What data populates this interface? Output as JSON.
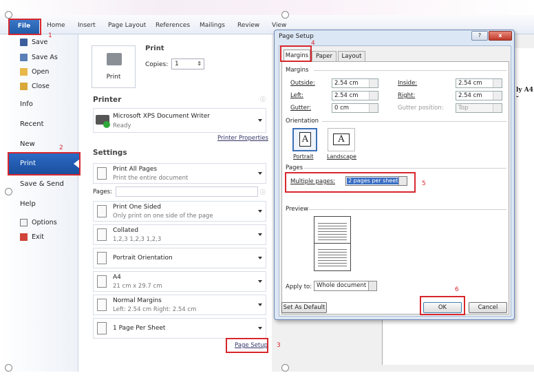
{
  "ribbon": {
    "file": "File",
    "tabs": [
      "Home",
      "Insert",
      "Page Layout",
      "References",
      "Mailings",
      "Review",
      "View"
    ]
  },
  "nav": {
    "items": [
      {
        "label": "Save",
        "icon": "save-icon"
      },
      {
        "label": "Save As",
        "icon": "save-as-icon"
      },
      {
        "label": "Open",
        "icon": "open-folder-icon"
      },
      {
        "label": "Close",
        "icon": "close-folder-icon"
      }
    ],
    "info": "Info",
    "recent": "Recent",
    "new": "New",
    "print": "Print",
    "save_send": "Save & Send",
    "help": "Help",
    "options": "Options",
    "exit": "Exit"
  },
  "print": {
    "heading": "Print",
    "button": "Print",
    "copies_label": "Copies:",
    "copies_value": "1"
  },
  "printer": {
    "heading": "Printer",
    "name": "Microsoft XPS Document Writer",
    "status": "Ready",
    "properties_link": "Printer Properties"
  },
  "settings": {
    "heading": "Settings",
    "pages_label": "Pages:",
    "page_setup_link": "Page Setup",
    "options": [
      {
        "main": "Print All Pages",
        "sub": "Print the entire document"
      },
      {
        "main": "Print One Sided",
        "sub": "Only print on one side of the page"
      },
      {
        "main": "Collated",
        "sub": "1,2,3   1,2,3   1,2,3"
      },
      {
        "main": "Portrait Orientation",
        "sub": ""
      },
      {
        "main": "A4",
        "sub": "21 cm x 29.7 cm"
      },
      {
        "main": "Normal Margins",
        "sub": "Left: 2.54 cm   Right: 2.54 cm"
      },
      {
        "main": "1 Page Per Sheet",
        "sub": ""
      }
    ]
  },
  "dialog": {
    "title": "Page Setup",
    "tabs": [
      "Margins",
      "Paper",
      "Layout"
    ],
    "margins_group": "Margins",
    "outside_label": "Outside:",
    "outside_value": "2.54 cm",
    "inside_label": "Inside:",
    "inside_value": "2.54 cm",
    "left_label": "Left:",
    "left_value": "2.54 cm",
    "right_label": "Right:",
    "right_value": "2.54 cm",
    "gutter_label": "Gutter:",
    "gutter_value": "0 cm",
    "gutter_pos_label": "Gutter position:",
    "gutter_pos_value": "Top",
    "orientation_group": "Orientation",
    "portrait": "Portrait",
    "landscape": "Landscape",
    "pages_group": "Pages",
    "multiple_pages_label": "Multiple pages:",
    "multiple_pages_value": "2 pages per sheet",
    "preview_group": "Preview",
    "apply_label": "Apply to:",
    "apply_value": "Whole document",
    "default_button": "Set As Default",
    "ok_button": "OK",
    "cancel_button": "Cancel",
    "help_glyph": "?",
    "close_glyph": "x"
  },
  "doc_snippet": "ly A4 -",
  "annotations": [
    "1",
    "2",
    "3",
    "4",
    "5",
    "6"
  ],
  "colors": {
    "accent": "#1f5aa6",
    "annotation": "#d8262c"
  }
}
